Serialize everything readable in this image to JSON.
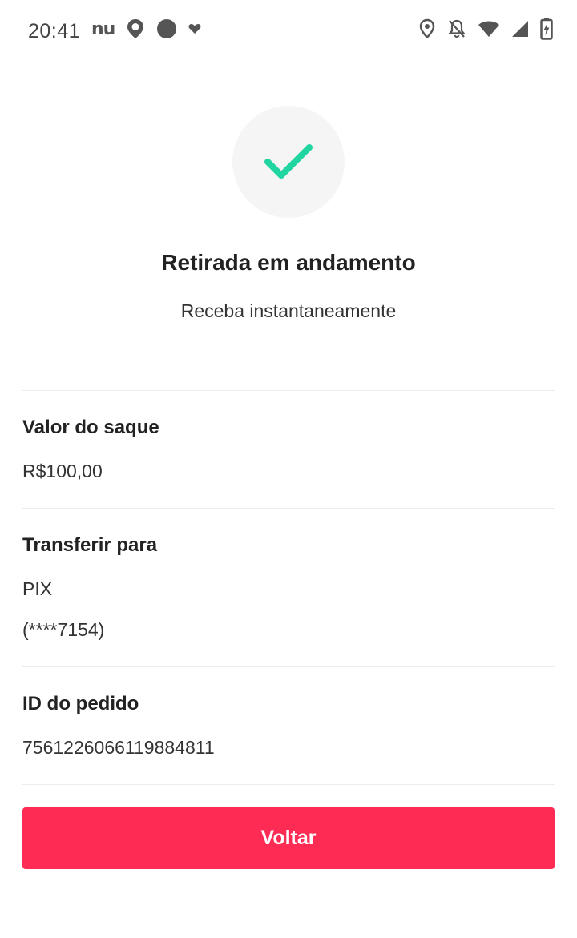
{
  "status_bar": {
    "time": "20:41",
    "app_logo_text": "nu",
    "left_icons": [
      "nu-logo",
      "location-pin-icon",
      "circle-icon",
      "heart-icon"
    ],
    "right_icons": [
      "location-icon",
      "notifications-off-icon",
      "wifi-icon",
      "signal-icon",
      "battery-charging-icon"
    ]
  },
  "status": {
    "icon": "check-icon",
    "icon_color": "#20d5a0",
    "title": "Retirada em andamento",
    "subtitle": "Receba instantaneamente"
  },
  "details": {
    "amount_label": "Valor do saque",
    "amount_value": "R$100,00",
    "transfer_label": "Transferir para",
    "transfer_method": "PIX",
    "transfer_account": "(****7154)",
    "order_label": "ID do pedido",
    "order_id": "7561226066119884811"
  },
  "actions": {
    "back_label": "Voltar",
    "back_color": "#fe2c55"
  }
}
